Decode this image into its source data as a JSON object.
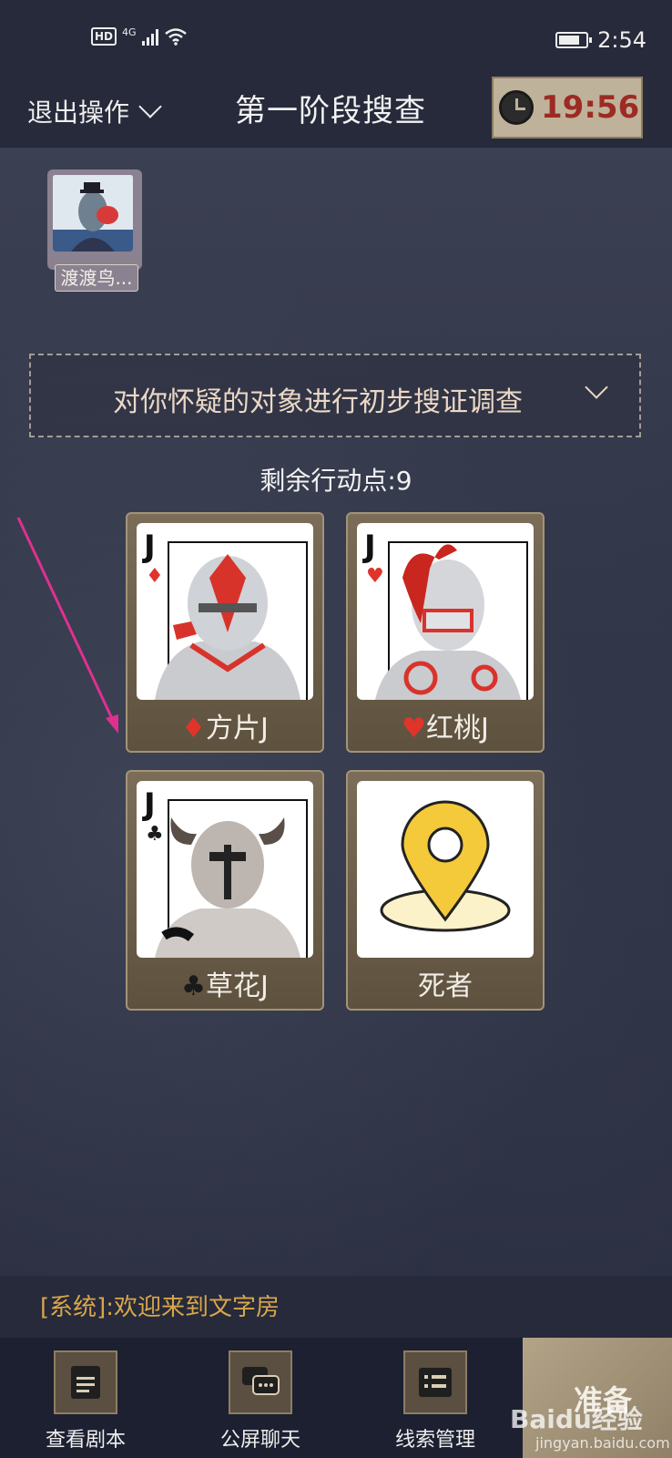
{
  "status_bar": {
    "network": "4G",
    "hd": "HD",
    "time": "2:54"
  },
  "header": {
    "exit_label": "退出操作",
    "title": "第一阶段搜查",
    "timer": "19:56"
  },
  "avatar": {
    "name": "渡渡鸟..."
  },
  "task_dropdown": {
    "text": "对你怀疑的对象进行初步搜证调查"
  },
  "action_points": "剩余行动点:9",
  "cards": [
    {
      "suit_symbol": "♦",
      "label": "方片J",
      "rank": "J"
    },
    {
      "suit_symbol": "♥",
      "label": "红桃J",
      "rank": "J"
    },
    {
      "suit_symbol": "♣",
      "label": "草花J",
      "rank": "J"
    },
    {
      "label": "死者"
    }
  ],
  "chat": {
    "system_message": "[系统]:欢迎来到文字房"
  },
  "bottom_tabs": [
    {
      "label": "查看剧本",
      "icon": "script-book-icon"
    },
    {
      "label": "公屏聊天",
      "icon": "chat-bubble-icon"
    },
    {
      "label": "线索管理",
      "icon": "clue-list-icon"
    }
  ],
  "ready_button": {
    "label": "准备"
  },
  "watermark": {
    "brand": "Baidu经验",
    "url": "jingyan.baidu.com"
  },
  "colors": {
    "timer_text": "#9c2b23",
    "system_text": "#d9a64a",
    "arrow": "#e0308f"
  }
}
